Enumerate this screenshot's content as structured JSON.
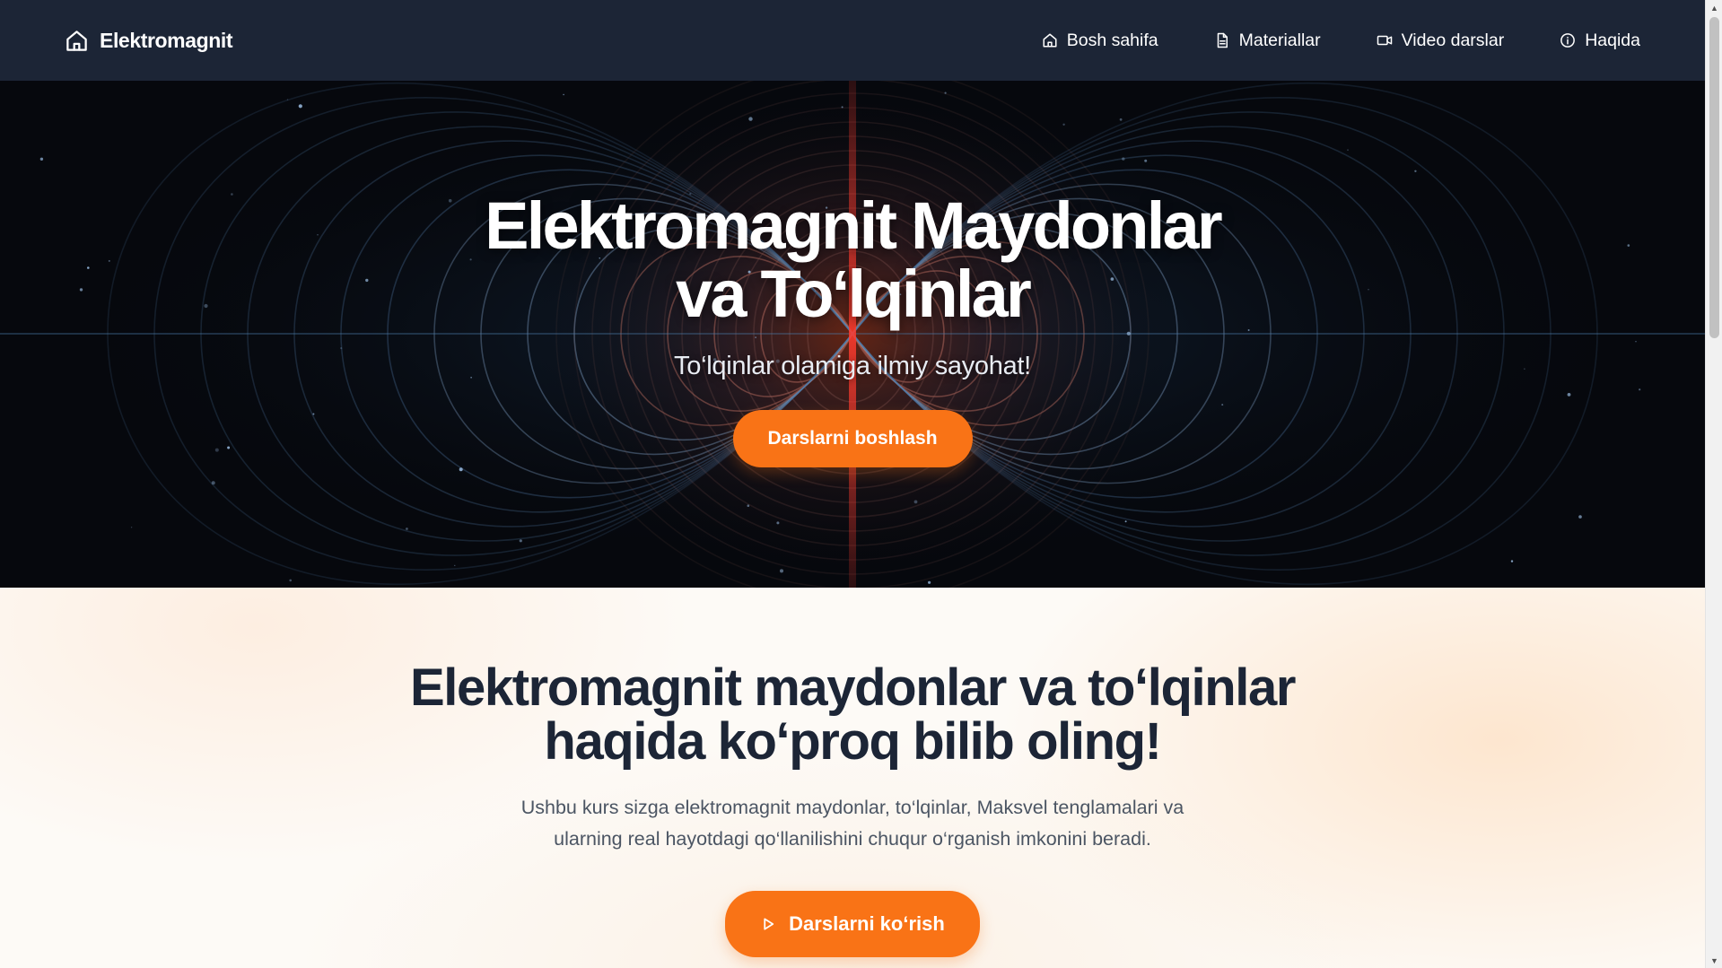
{
  "navbar": {
    "brand": "Elektromagnit",
    "links": [
      {
        "label": "Bosh sahifa",
        "icon": "home-icon"
      },
      {
        "label": "Materiallar",
        "icon": "document-icon"
      },
      {
        "label": "Video darslar",
        "icon": "video-icon"
      },
      {
        "label": "Haqida",
        "icon": "info-icon"
      }
    ]
  },
  "hero": {
    "title_line1": "Elektromagnit Maydonlar",
    "title_line2": "va To‘lqinlar",
    "subtitle": "To‘lqinlar olamiga ilmiy sayohat!",
    "button_label": "Darslarni boshlash"
  },
  "info": {
    "title_line1": "Elektromagnit maydonlar va to‘lqinlar",
    "title_line2": "haqida ko‘proq bilib oling!",
    "text_line1": "Ushbu kurs sizga elektromagnit maydonlar, to‘lqinlar, Maksvel tenglamalari va",
    "text_line2": "ularning real hayotdagi qo‘llanilishini chuqur o‘rganish imkonini beradi.",
    "button_label": "Darslarni ko‘rish",
    "button_icon": "play-icon"
  },
  "colors": {
    "navbar_bg": "#1c2536",
    "accent": "#f97316",
    "heading_dark": "#1c2536",
    "body_text": "#4b5563"
  }
}
